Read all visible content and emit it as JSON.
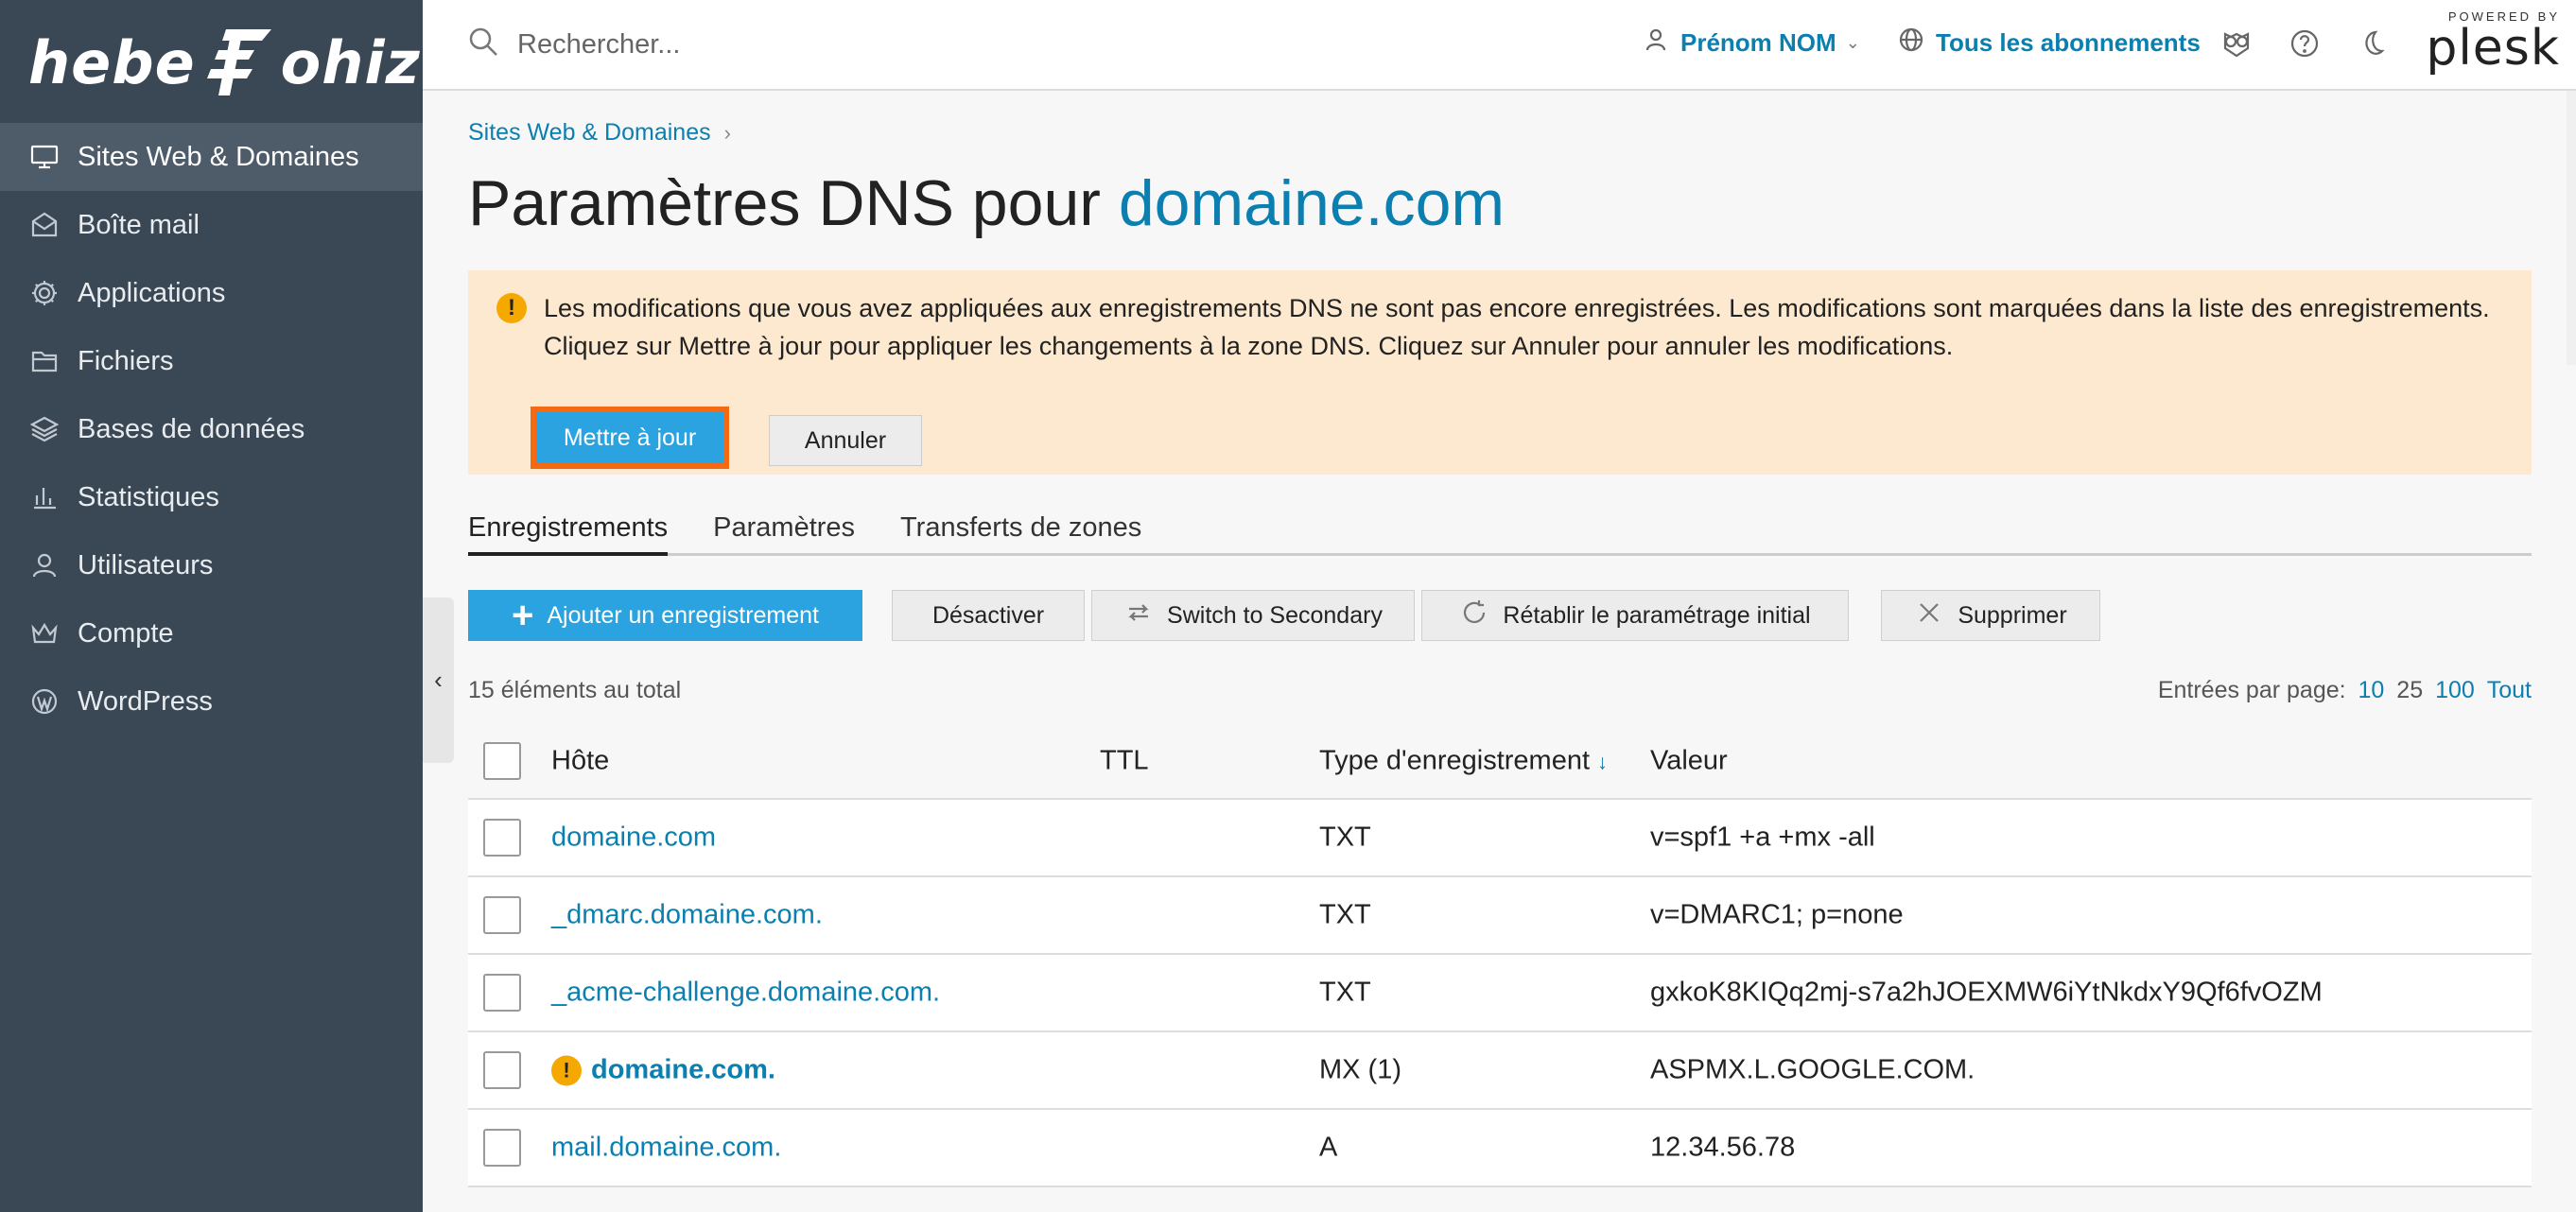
{
  "logo": {
    "left": "hebe",
    "right": "ohiz"
  },
  "sidebar": {
    "items": [
      {
        "label": "Sites Web & Domaines",
        "icon": "monitor-icon",
        "active": true
      },
      {
        "label": "Boîte mail",
        "icon": "mail-icon"
      },
      {
        "label": "Applications",
        "icon": "gear-icon"
      },
      {
        "label": "Fichiers",
        "icon": "folder-icon"
      },
      {
        "label": "Bases de données",
        "icon": "layers-icon"
      },
      {
        "label": "Statistiques",
        "icon": "bar-chart-icon"
      },
      {
        "label": "Utilisateurs",
        "icon": "user-icon"
      },
      {
        "label": "Compte",
        "icon": "crown-icon"
      },
      {
        "label": "WordPress",
        "icon": "wordpress-icon"
      }
    ]
  },
  "header": {
    "search_placeholder": "Rechercher...",
    "user_name": "Prénom NOM",
    "subscriptions": "Tous les abonnements",
    "powered_by": "POWERED BY",
    "plesk": "plesk"
  },
  "breadcrumb": {
    "item": "Sites Web & Domaines"
  },
  "page": {
    "title_prefix": "Paramètres DNS pour",
    "title_domain": "domaine.com"
  },
  "alert": {
    "message": "Les modifications que vous avez appliquées aux enregistrements DNS ne sont pas encore enregistrées. Les modifications sont marquées dans la liste des enregistrements. Cliquez sur Mettre à jour pour appliquer les changements à la zone DNS. Cliquez sur Annuler pour annuler les modifications.",
    "update_label": "Mettre à jour",
    "cancel_label": "Annuler"
  },
  "tabs": [
    "Enregistrements",
    "Paramètres",
    "Transferts de zones"
  ],
  "toolbar": {
    "add": "Ajouter un enregistrement",
    "disable": "Désactiver",
    "switch": "Switch to Secondary",
    "restore": "Rétablir le paramétrage initial",
    "delete": "Supprimer"
  },
  "list": {
    "total": "15 éléments au total",
    "per_page_label": "Entrées par page:",
    "per_page_options": [
      "10",
      "25",
      "100",
      "Tout"
    ],
    "per_page_current": "25"
  },
  "table": {
    "headers": {
      "host": "Hôte",
      "ttl": "TTL",
      "type": "Type d'enregistrement",
      "value": "Valeur"
    },
    "rows": [
      {
        "host": "domaine.com",
        "ttl": "",
        "type": "TXT",
        "value": "v=spf1 +a +mx -all",
        "modified": false
      },
      {
        "host": "_dmarc.domaine.com.",
        "ttl": "",
        "type": "TXT",
        "value": "v=DMARC1; p=none",
        "modified": false
      },
      {
        "host": "_acme-challenge.domaine.com.",
        "ttl": "",
        "type": "TXT",
        "value": "gxkoK8KIQq2mj-s7a2hJOEXMW6iYtNkdxY9Qf6fvOZM",
        "modified": false
      },
      {
        "host": "domaine.com.",
        "ttl": "",
        "type": "MX (1)",
        "value": "ASPMX.L.GOOGLE.COM.",
        "modified": true
      },
      {
        "host": "mail.domaine.com.",
        "ttl": "",
        "type": "A",
        "value": "12.34.56.78",
        "modified": false
      }
    ]
  },
  "colors": {
    "sidebar": "#3a4755",
    "accent": "#2aa3e0",
    "link": "#0a7fb0",
    "alert_bg": "#fde9cf",
    "highlight": "#f46a12"
  }
}
